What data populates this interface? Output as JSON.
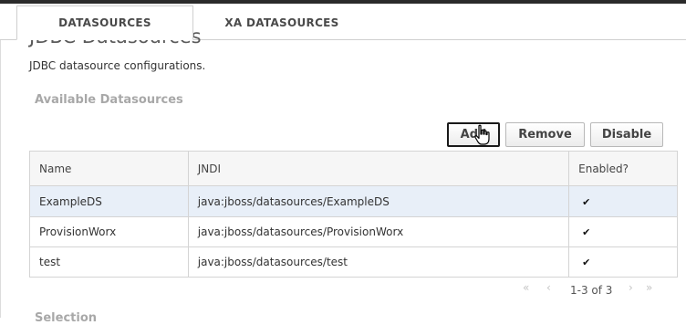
{
  "tabs": [
    {
      "label": "DATASOURCES",
      "active": true
    },
    {
      "label": "XA DATASOURCES",
      "active": false
    }
  ],
  "page": {
    "title": "JDBC Datasources",
    "description": "JDBC datasource configurations.",
    "section_title": "Available Datasources",
    "next_section_partial": "Selection"
  },
  "toolbar": {
    "add_label": "Add",
    "remove_label": "Remove",
    "disable_label": "Disable"
  },
  "table": {
    "columns": [
      "Name",
      "JNDI",
      "Enabled?"
    ],
    "rows": [
      {
        "name": "ExampleDS",
        "jndi": "java:jboss/datasources/ExampleDS",
        "enabled": "✔",
        "selected": true
      },
      {
        "name": "ProvisionWorx",
        "jndi": "java:jboss/datasources/ProvisionWorx",
        "enabled": "✔",
        "selected": false
      },
      {
        "name": "test",
        "jndi": "java:jboss/datasources/test",
        "enabled": "✔",
        "selected": false
      }
    ]
  },
  "pager": {
    "first": "«",
    "prev": "‹",
    "info": "1-3 of 3",
    "next": "›",
    "last": "»"
  },
  "colors": {
    "selected_row": "#e8eff8",
    "section_title": "#a8a8a8",
    "top_bar": "#2b2b2b"
  },
  "icons": {
    "enabled_mark": "checkmark-icon",
    "cursor": "hand-pointer-icon"
  }
}
